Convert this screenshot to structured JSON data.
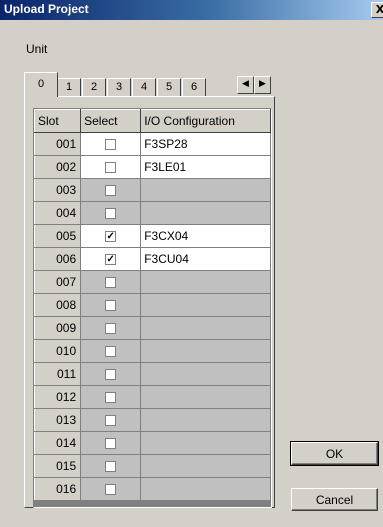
{
  "window": {
    "title": "Upload Project",
    "close_label": "X"
  },
  "unit": {
    "label": "Unit",
    "tabs": [
      "0",
      "1",
      "2",
      "3",
      "4",
      "5",
      "6"
    ],
    "active_tab": "0"
  },
  "table": {
    "headers": {
      "slot": "Slot",
      "select": "Select",
      "io": "I/O Configuration"
    },
    "rows": [
      {
        "slot": "001",
        "checked": false,
        "io": "F3SP28"
      },
      {
        "slot": "002",
        "checked": false,
        "io": "F3LE01"
      },
      {
        "slot": "003",
        "checked": false,
        "io": ""
      },
      {
        "slot": "004",
        "checked": false,
        "io": ""
      },
      {
        "slot": "005",
        "checked": true,
        "io": "F3CX04"
      },
      {
        "slot": "006",
        "checked": true,
        "io": "F3CU04"
      },
      {
        "slot": "007",
        "checked": false,
        "io": ""
      },
      {
        "slot": "008",
        "checked": false,
        "io": ""
      },
      {
        "slot": "009",
        "checked": false,
        "io": ""
      },
      {
        "slot": "010",
        "checked": false,
        "io": ""
      },
      {
        "slot": "011",
        "checked": false,
        "io": ""
      },
      {
        "slot": "012",
        "checked": false,
        "io": ""
      },
      {
        "slot": "013",
        "checked": false,
        "io": ""
      },
      {
        "slot": "014",
        "checked": false,
        "io": ""
      },
      {
        "slot": "015",
        "checked": false,
        "io": ""
      },
      {
        "slot": "016",
        "checked": false,
        "io": ""
      }
    ]
  },
  "buttons": {
    "ok": "OK",
    "cancel": "Cancel"
  },
  "colors": {
    "title_bar": "#0a246a",
    "face": "#d4d0c8",
    "disabled_cell": "#c0c0c0",
    "active_cell": "#ffffff"
  }
}
